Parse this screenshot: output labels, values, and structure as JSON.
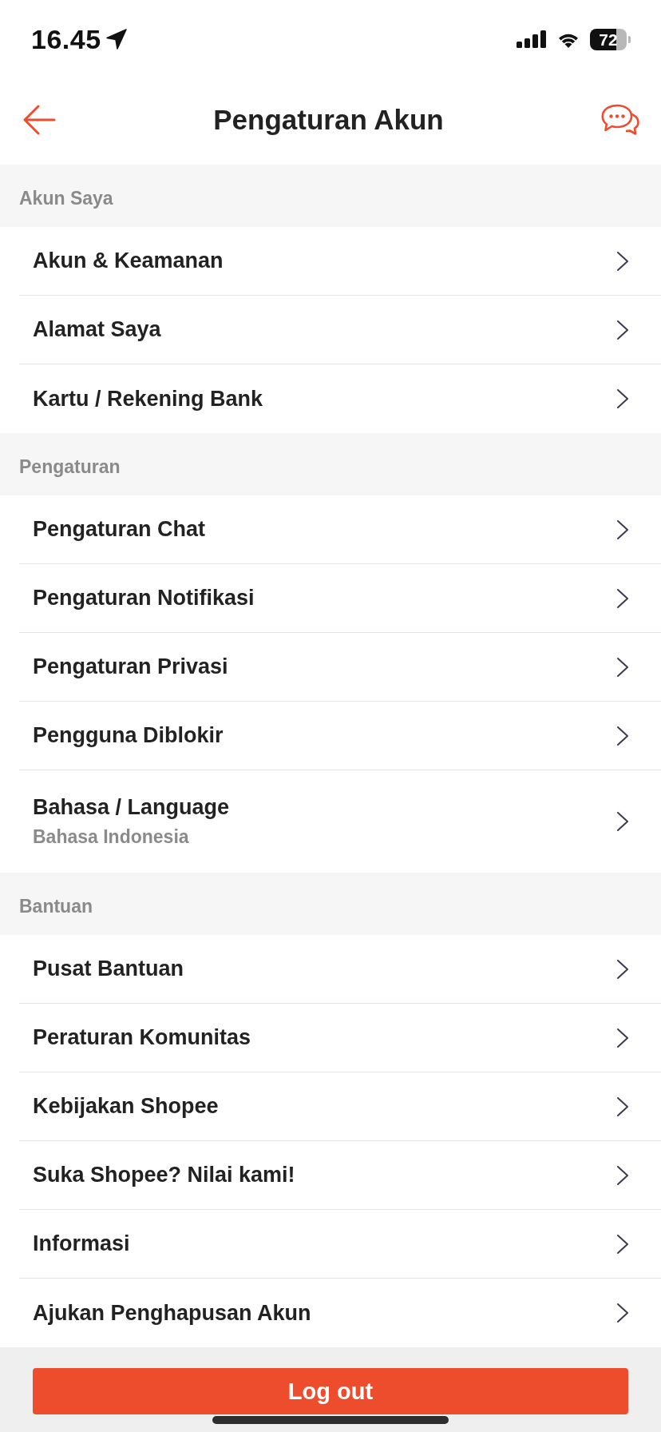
{
  "status_bar": {
    "time": "16.45",
    "battery": "72"
  },
  "header": {
    "title": "Pengaturan Akun"
  },
  "sections": [
    {
      "title": "Akun Saya",
      "items": [
        {
          "label": "Akun & Keamanan"
        },
        {
          "label": "Alamat Saya"
        },
        {
          "label": "Kartu / Rekening Bank"
        }
      ]
    },
    {
      "title": "Pengaturan",
      "items": [
        {
          "label": "Pengaturan Chat"
        },
        {
          "label": "Pengaturan Notifikasi"
        },
        {
          "label": "Pengaturan Privasi"
        },
        {
          "label": "Pengguna Diblokir"
        },
        {
          "label": "Bahasa / Language",
          "value": "Bahasa Indonesia"
        }
      ]
    },
    {
      "title": "Bantuan",
      "items": [
        {
          "label": "Pusat Bantuan"
        },
        {
          "label": "Peraturan Komunitas"
        },
        {
          "label": "Kebijakan Shopee"
        },
        {
          "label": "Suka Shopee? Nilai kami!"
        },
        {
          "label": "Informasi"
        },
        {
          "label": "Ajukan Penghapusan Akun"
        }
      ]
    }
  ],
  "logout_button": {
    "label": "Log out"
  }
}
